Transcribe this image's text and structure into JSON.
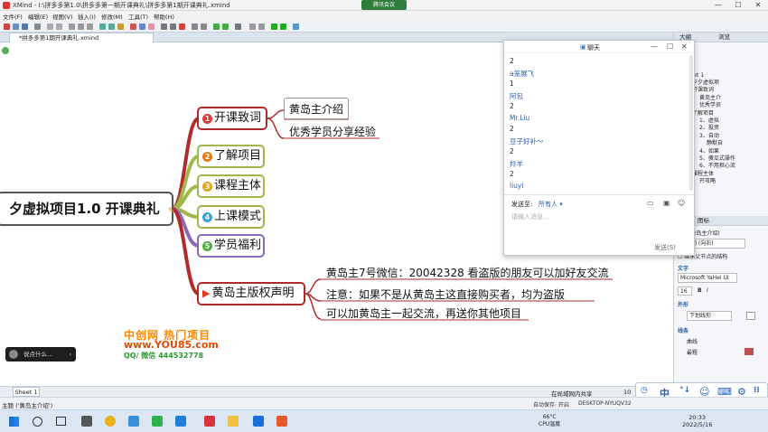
{
  "window": {
    "title": "XMind - I:\\拼多多第1.0\\拼多多第一期开课典礼\\拼多多第1期开课典礼.xmind",
    "meeting_badge": "腾讯会议",
    "min": "—",
    "max": "☐",
    "close": "✕"
  },
  "menubar": [
    "文件(F)",
    "编辑(E)",
    "视图(V)",
    "插入(I)",
    "修改(M)",
    "工具(T)",
    "帮助(H)"
  ],
  "editor_tab": "*拼多多第1期开课典礼.xmind",
  "mindmap": {
    "central": "夕虚拟项目1.0 开课典礼",
    "branches": [
      {
        "num": "1",
        "label": "开课致词",
        "color": "#b22b2b"
      },
      {
        "num": "2",
        "label": "了解项目",
        "color": "#8aa830"
      },
      {
        "num": "3",
        "label": "课程主体",
        "color": "#8aa830"
      },
      {
        "num": "4",
        "label": "上课模式",
        "color": "#8aa830"
      },
      {
        "num": "5",
        "label": "学员福利",
        "color": "#7a5aa8"
      },
      {
        "num": "",
        "label": "黄岛主版权声明",
        "color": "#b22b2b"
      }
    ],
    "sub_welcome": [
      "黄岛主介绍",
      "优秀学员分享经验"
    ],
    "sub_copyright": [
      "黄岛主7号微信：20042328 看盗版的朋友可以加好友交流",
      "注意：如果不是从黄岛主这直接购买者，均为盗版",
      "可以加黄岛主一起交流，再送你其他项目"
    ]
  },
  "watermark": {
    "line1": "中创网 热门项目",
    "line2": "www.YOU85.com",
    "line3": "QQ/ 微信 444532778"
  },
  "comment": {
    "placeholder": "说点什么..."
  },
  "chat": {
    "title": "聊天",
    "messages": [
      {
        "text": "2",
        "style": "plain"
      },
      {
        "text": "a笼展飞",
        "style": "name"
      },
      {
        "text": "1",
        "style": "plain"
      },
      {
        "text": "阿包",
        "style": "name"
      },
      {
        "text": "2",
        "style": "plain"
      },
      {
        "text": "Mr.Liu",
        "style": "name"
      },
      {
        "text": "2",
        "style": "plain"
      },
      {
        "text": "豆子好补～",
        "style": "name"
      },
      {
        "text": "2",
        "style": "plain"
      },
      {
        "text": "羚羊",
        "style": "name"
      },
      {
        "text": "2",
        "style": "plain"
      },
      {
        "text": "liuyi",
        "style": "name"
      }
    ],
    "send_to_label": "发送至:",
    "send_to_target": "所有人 ▾",
    "input_placeholder": "请输入消息...",
    "send_button": "发送(S)"
  },
  "right_panel": {
    "tabs": [
      "大纲",
      "浏览"
    ],
    "outline_header": "详细",
    "sheet": "Sheet 1",
    "tree": [
      "拼夕夕虚拟项",
      "开课致词",
      "黄岛主介",
      "优秀学员",
      "了解项目",
      "1、虚拟",
      "2、投资",
      "3、自动",
      "静默自",
      "4、如果",
      "5、傻瓜式操作",
      "6、不用担心流",
      "课程主体",
      "开攻略"
    ],
    "props_header": "图标",
    "props_title": "主题(黄岛主介绍)",
    "structure": "逻辑图 (向右)",
    "inherit": "继承父节点的结构",
    "text_section": "文字",
    "font": "Microsoft YaHei UI",
    "font_size": "16",
    "style_section": "外形",
    "shape": "下划线形",
    "line_section": "线条",
    "line_type": "曲线",
    "line_width": "最粗"
  },
  "sheetbar": {
    "tab": "Sheet 1",
    "share": "在局域网内共享",
    "zoom": "10"
  },
  "statusbar": {
    "text": "主题 ('黄岛主介绍')",
    "autosave": "自动保存: 开启",
    "machine": "DESKTOP-NYUQV32"
  },
  "taskbar": {
    "temp": "66°C",
    "cpu": "CPU温度",
    "time": "20:33",
    "date": "2022/5/16"
  },
  "ime": [
    "中",
    "°↓",
    "☺",
    "⌨",
    "⚙"
  ]
}
